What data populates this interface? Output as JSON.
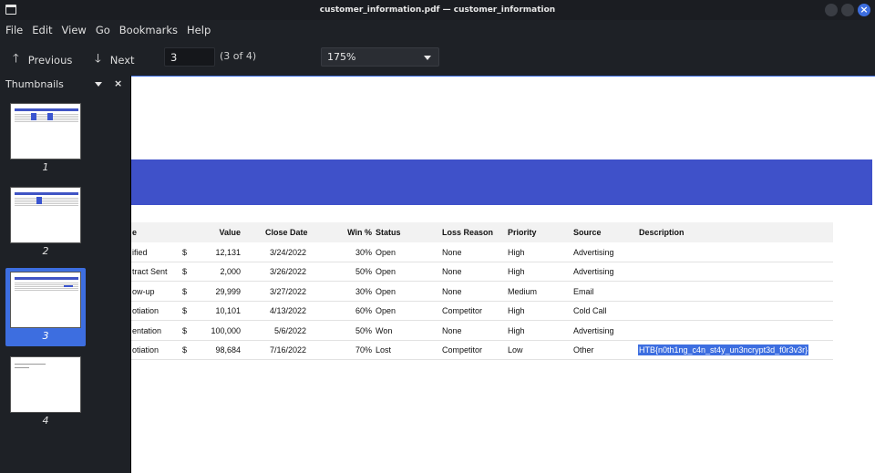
{
  "window": {
    "title": "customer_information.pdf — customer_information"
  },
  "menu": [
    "File",
    "Edit",
    "View",
    "Go",
    "Bookmarks",
    "Help"
  ],
  "toolbar": {
    "previous_label": "Previous",
    "next_label": "Next",
    "page_value": "3",
    "page_of": "(3 of 4)",
    "zoom_value": "175%"
  },
  "sidebar": {
    "title": "Thumbnails",
    "pages": [
      "1",
      "2",
      "3",
      "4"
    ],
    "selected_page": "3"
  },
  "table": {
    "headers": [
      "e",
      "Value",
      "Close Date",
      "Win %",
      "Status",
      "Loss Reason",
      "Priority",
      "Source",
      "Description"
    ],
    "rows": [
      [
        "ified",
        "$",
        "12,131",
        "3/24/2022",
        "30%",
        "Open",
        "None",
        "High",
        "Advertising",
        ""
      ],
      [
        "tract Sent",
        "$",
        "2,000",
        "3/26/2022",
        "50%",
        "Open",
        "None",
        "High",
        "Advertising",
        ""
      ],
      [
        "ow-up",
        "$",
        "29,999",
        "3/27/2022",
        "30%",
        "Open",
        "None",
        "Medium",
        "Email",
        ""
      ],
      [
        "otiation",
        "$",
        "10,101",
        "4/13/2022",
        "60%",
        "Open",
        "Competitor",
        "High",
        "Cold Call",
        ""
      ],
      [
        "entation",
        "$",
        "100,000",
        "5/6/2022",
        "50%",
        "Won",
        "None",
        "High",
        "Advertising",
        ""
      ],
      [
        "otiation",
        "$",
        "98,684",
        "7/16/2022",
        "70%",
        "Lost",
        "Competitor",
        "Low",
        "Other",
        "HTB{n0th1ng_c4n_st4y_un3ncrypt3d_f0r3v3r}"
      ]
    ]
  },
  "colors": {
    "accent": "#3d6ee0",
    "band": "#3f51c9",
    "chrome": "#1e2126"
  }
}
